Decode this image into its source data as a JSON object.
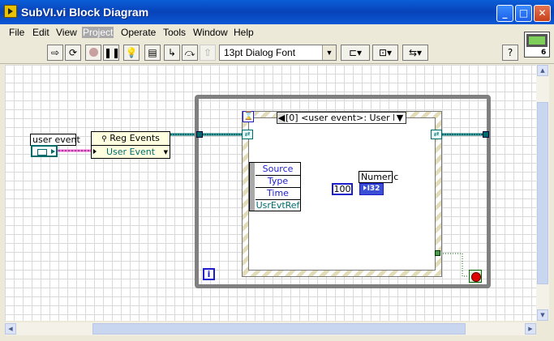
{
  "window": {
    "title": "SubVI.vi Block Diagram"
  },
  "window_buttons": {
    "minimize": "_",
    "maximize": "□",
    "close": "✕"
  },
  "menu": [
    "File",
    "Edit",
    "View",
    "Project",
    "Operate",
    "Tools",
    "Window",
    "Help"
  ],
  "toolbar": {
    "font": "13pt Dialog Font",
    "help": "?"
  },
  "diagram": {
    "user_event_label": "user event",
    "reg_events_title": "Reg Events",
    "reg_events_item": "User Event",
    "case_selector": "[0] <user event>: User E",
    "event_data": [
      "Source",
      "Type",
      "Time",
      "UsrEvtRef"
    ],
    "numeric_label": "Numeric",
    "numeric_const": "100",
    "numeric_type": "I32",
    "iteration": "i"
  },
  "colors": {
    "accent": "#1c1ccc",
    "event_wire": "#ff66cc",
    "refnum_wire": "#006b6b",
    "stop": "#dd0000"
  }
}
